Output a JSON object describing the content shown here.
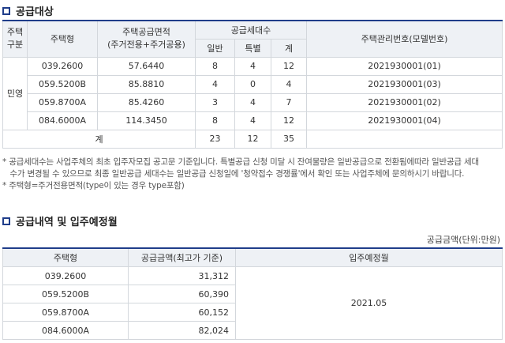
{
  "section1": {
    "title": "공급대상",
    "headers": {
      "type_group": "주택\n구분",
      "house_type": "주택형",
      "area": "주택공급면적\n(주거전용+주거공용)",
      "units": "공급세대수",
      "general": "일반",
      "special": "특별",
      "total": "계",
      "mgmt_no": "주택관리번호(모델번호)"
    },
    "group_label": "민영",
    "rows": [
      {
        "type": "039.2600",
        "area": "57.6440",
        "general": "8",
        "special": "4",
        "total": "12",
        "mgmt": "2021930001(01)"
      },
      {
        "type": "059.5200B",
        "area": "85.8810",
        "general": "4",
        "special": "0",
        "total": "4",
        "mgmt": "2021930001(03)"
      },
      {
        "type": "059.8700A",
        "area": "85.4260",
        "general": "3",
        "special": "4",
        "total": "7",
        "mgmt": "2021930001(02)"
      },
      {
        "type": "084.6000A",
        "area": "114.3450",
        "general": "8",
        "special": "4",
        "total": "12",
        "mgmt": "2021930001(04)"
      }
    ],
    "sum": {
      "label": "계",
      "general": "23",
      "special": "12",
      "total": "35"
    },
    "notes": [
      "* 공급세대수는 사업주체의 최초 입주자모집 공고문 기준입니다. 특별공급 신청 미달 시 잔여물량은 일반공급으로 전환됨에따라 일반공급 세대",
      "   수가 변경될 수 있으므로 최종 일반공급 세대수는 일반공급 신청일에 '청약접수 경쟁률'에서 확인 또는 사업주체에 문의하시기 바랍니다.",
      "* 주택형=주거전용면적(type이 있는 경우 type포함)"
    ]
  },
  "section2": {
    "title": "공급내역 및 입주예정월",
    "unit_label": "공급금액(단위:만원)",
    "headers": {
      "house_type": "주택형",
      "price": "공급금액(최고가 기준)",
      "move_in": "입주예정월"
    },
    "rows": [
      {
        "type": "039.2600",
        "price": "31,312"
      },
      {
        "type": "059.5200B",
        "price": "60,390"
      },
      {
        "type": "059.8700A",
        "price": "60,152"
      },
      {
        "type": "084.6000A",
        "price": "82,024"
      }
    ],
    "move_in_month": "2021.05"
  },
  "colors": {
    "accent": "#1f3d8a",
    "header_bg": "#eef1f5",
    "border": "#d3d7dc"
  }
}
